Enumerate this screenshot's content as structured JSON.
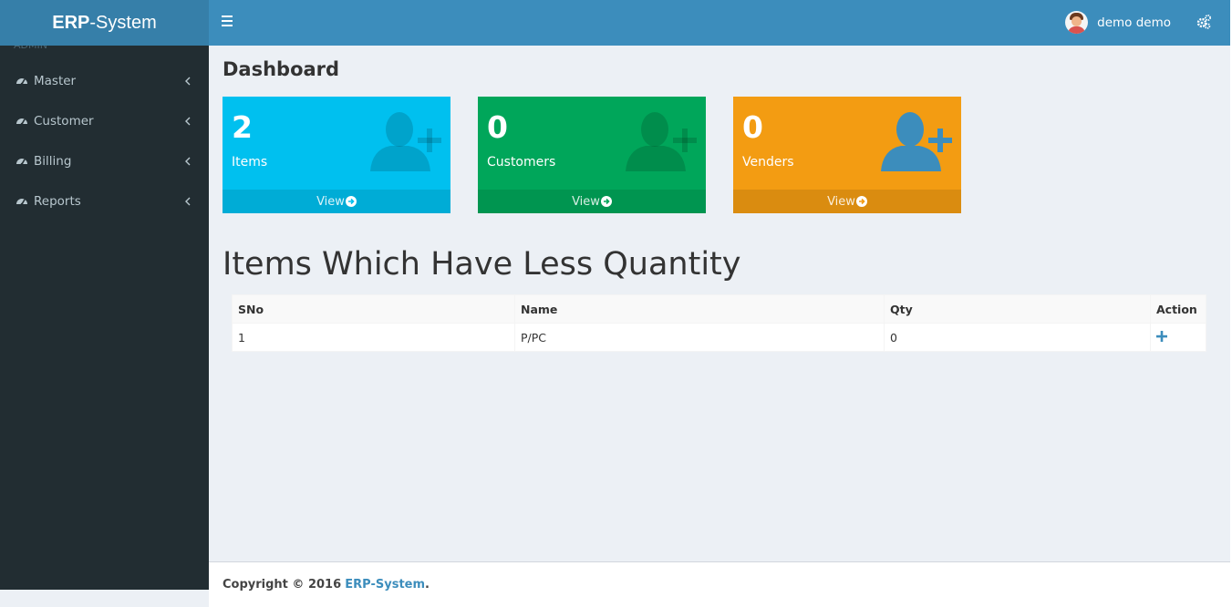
{
  "header": {
    "logo_bold": "ERP",
    "logo_rest": "-System",
    "user_name": "demo demo",
    "icons": [
      "bars-icon",
      "user-avatar",
      "gears-icon"
    ]
  },
  "sidebar": {
    "header": "ADMIN",
    "items": [
      {
        "label": "Master",
        "icon": "dashboard-icon"
      },
      {
        "label": "Customer",
        "icon": "dashboard-icon"
      },
      {
        "label": "Billing",
        "icon": "dashboard-icon"
      },
      {
        "label": "Reports",
        "icon": "dashboard-icon"
      }
    ]
  },
  "page": {
    "title": "Dashboard"
  },
  "stats": [
    {
      "value": "2",
      "label": "Items",
      "link": "View",
      "color": "#00c0ef"
    },
    {
      "value": "0",
      "label": "Customers",
      "link": "View",
      "color": "#00a65a"
    },
    {
      "value": "0",
      "label": "Venders",
      "link": "View",
      "color": "#f39c12"
    }
  ],
  "low_stock": {
    "title": "Items Which Have Less Quantity",
    "columns": [
      "SNo",
      "Name",
      "Qty",
      "Action"
    ],
    "rows": [
      {
        "sno": "1",
        "name": "P/PC",
        "qty": "0"
      }
    ]
  },
  "footer": {
    "copyright": "Copyright © 2016",
    "brand": "ERP-System",
    "suffix": "."
  },
  "colors": {
    "accent": "#3c8dbc",
    "sidebar": "#222d32"
  }
}
